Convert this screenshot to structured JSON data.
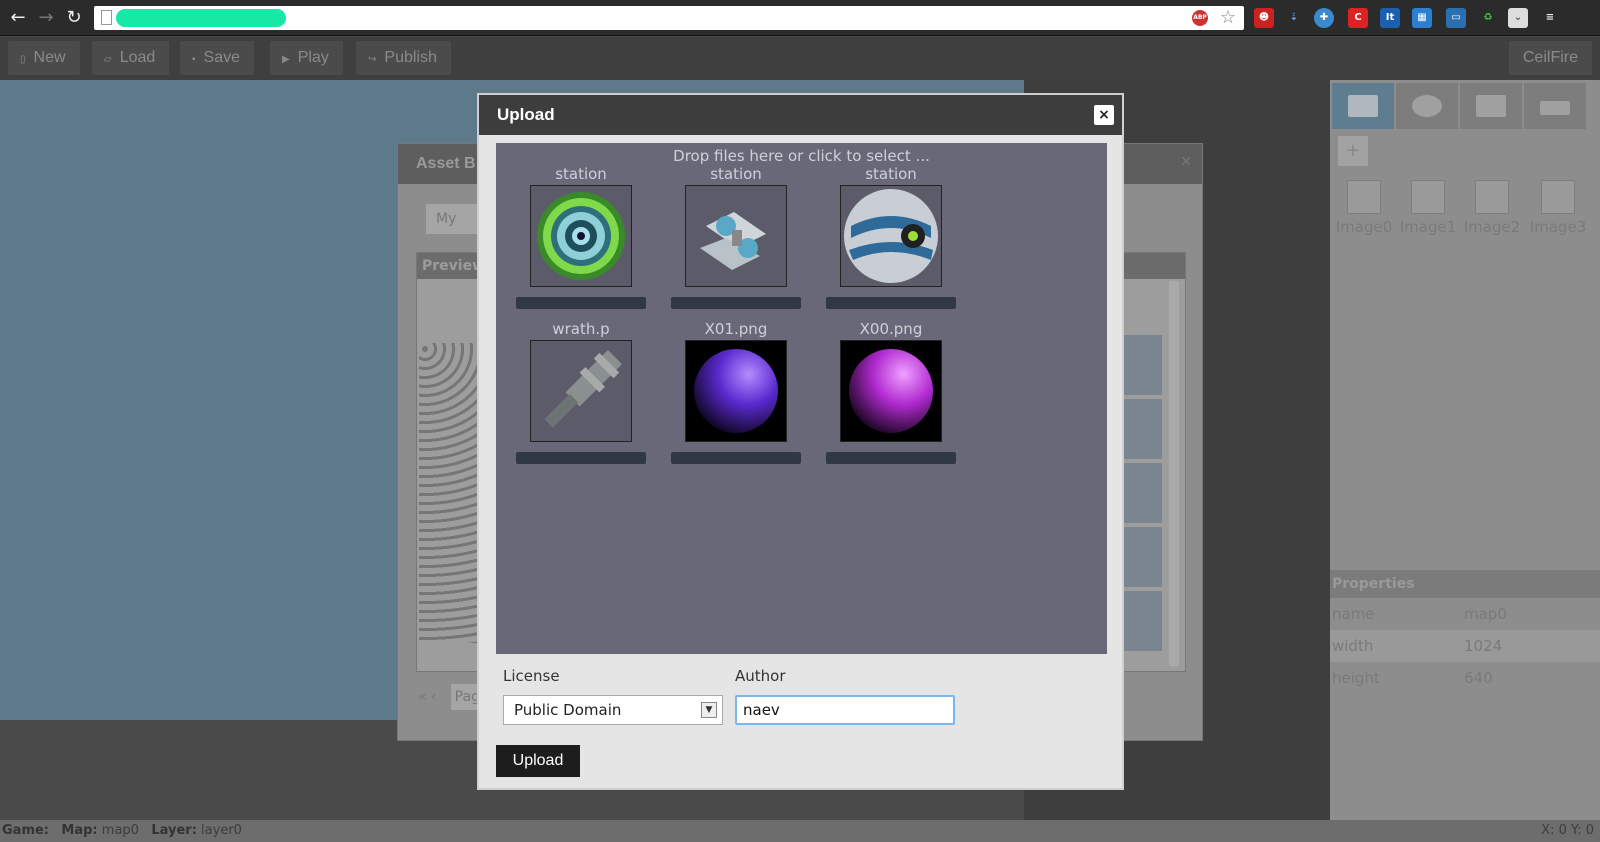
{
  "toolbar": {
    "new_label": "New",
    "load_label": "Load",
    "save_label": "Save",
    "play_label": "Play",
    "publish_label": "Publish",
    "user_label": "CeilFire"
  },
  "asset_browser": {
    "title": "Asset B",
    "tab_label": "My",
    "preview_label": "Preview",
    "pager_label": "Page",
    "pager_nav": "« ‹"
  },
  "right_panel": {
    "images": [
      "Image0",
      "Image1",
      "Image2",
      "Image3"
    ],
    "properties_label": "Properties",
    "properties": [
      {
        "key": "name",
        "value": "map0"
      },
      {
        "key": "width",
        "value": "1024"
      },
      {
        "key": "height",
        "value": "640"
      }
    ]
  },
  "status": {
    "game_label": "Game:",
    "map_label": "Map:",
    "map_value": "map0",
    "layer_label": "Layer:",
    "layer_value": "layer0",
    "coords": "X: 0   Y: 0"
  },
  "upload_dialog": {
    "title": "Upload",
    "close": "×",
    "drop_hint": "Drop files here or click to select ...",
    "files": [
      {
        "name": "station"
      },
      {
        "name": "station"
      },
      {
        "name": "station"
      },
      {
        "name": "wrath.p"
      },
      {
        "name": "X01.png"
      },
      {
        "name": "X00.png"
      }
    ],
    "license_label": "License",
    "license_value": "Public Domain",
    "author_label": "Author",
    "author_value": "naev",
    "upload_button": "Upload"
  }
}
